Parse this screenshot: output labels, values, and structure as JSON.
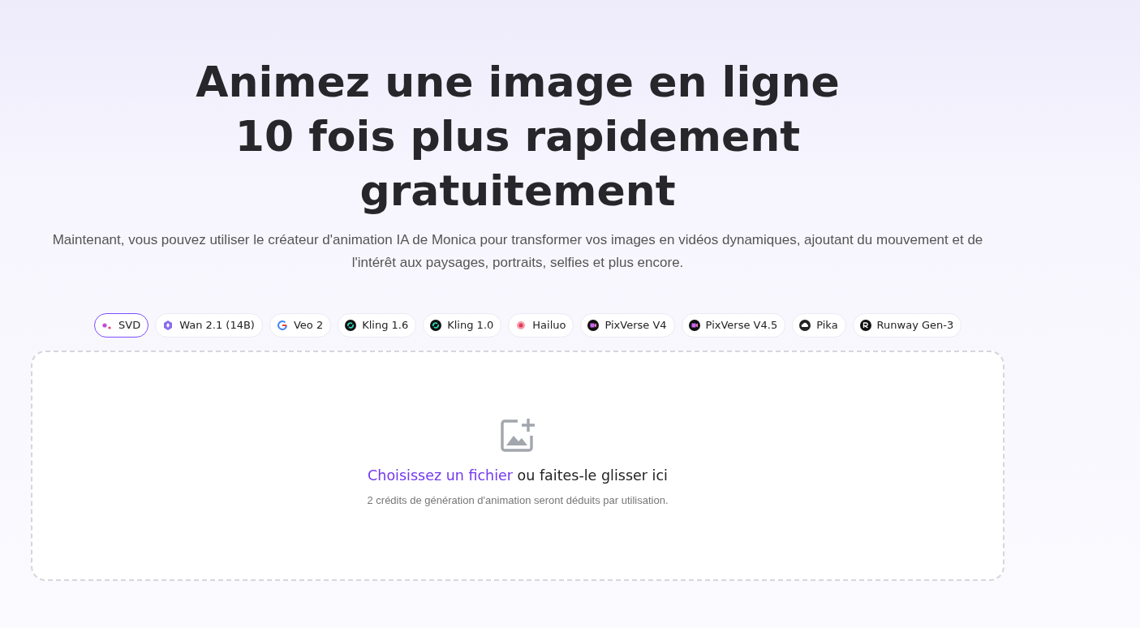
{
  "hero": {
    "title": "Animez une image en ligne 10 fois plus rapidement gratuitement",
    "subtitle": "Maintenant, vous pouvez utiliser le créateur d'animation IA de Monica pour transformer vos images en vidéos dynamiques, ajoutant du mouvement et de l'intérêt aux paysages, portraits, selfies et plus encore."
  },
  "models": [
    {
      "label": "SVD",
      "kind": "svd",
      "selected": true
    },
    {
      "label": "Wan 2.1 (14B)",
      "kind": "wan",
      "selected": false
    },
    {
      "label": "Veo 2",
      "kind": "google",
      "selected": false
    },
    {
      "label": "Kling 1.6",
      "kind": "kling",
      "selected": false
    },
    {
      "label": "Kling 1.0",
      "kind": "kling",
      "selected": false
    },
    {
      "label": "Hailuo",
      "kind": "hailuo",
      "selected": false
    },
    {
      "label": "PixVerse V4",
      "kind": "pixverse",
      "selected": false
    },
    {
      "label": "PixVerse V4.5",
      "kind": "pixverse",
      "selected": false
    },
    {
      "label": "Pika",
      "kind": "pika",
      "selected": false
    },
    {
      "label": "Runway Gen-3",
      "kind": "runway",
      "selected": false
    }
  ],
  "upload": {
    "link": "Choisissez un fichier",
    "rest": "ou faites-le glisser ici",
    "note": "2 crédits de génération d'animation seront déduits par utilisation."
  }
}
